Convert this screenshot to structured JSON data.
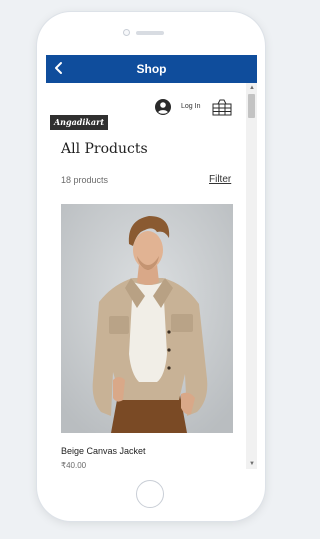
{
  "header": {
    "title": "Shop",
    "back_icon": "chevron-left-icon",
    "background_color": "#0f4d9c"
  },
  "account": {
    "login_label": "Log In",
    "avatar_icon": "user-avatar-icon",
    "cart_icon": "shopping-cart-icon"
  },
  "brand": {
    "logo_text": "Angadikart"
  },
  "main": {
    "title": "All Products",
    "product_count": "18 products",
    "filter_label": "Filter"
  },
  "products": [
    {
      "name": "Beige Canvas Jacket",
      "price": "₹40.00"
    }
  ],
  "scrollbar": {
    "up_icon": "scroll-up-arrow-icon",
    "down_icon": "scroll-down-arrow-icon"
  }
}
